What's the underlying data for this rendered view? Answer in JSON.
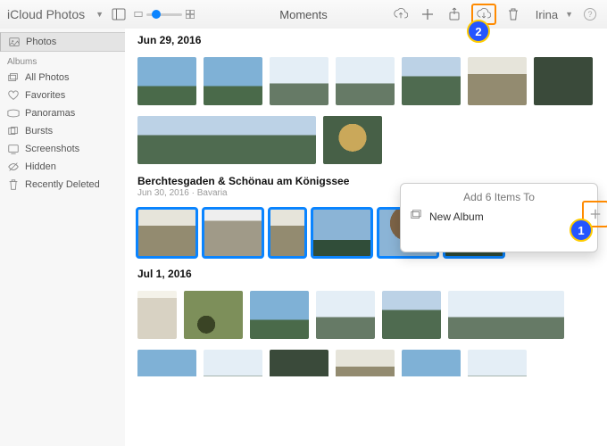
{
  "app": {
    "title": "iCloud Photos",
    "view_label": "Moments",
    "user": "Irina"
  },
  "sidebar": {
    "main": "Photos",
    "albums_header": "Albums",
    "items": [
      {
        "label": "All Photos"
      },
      {
        "label": "Favorites"
      },
      {
        "label": "Panoramas"
      },
      {
        "label": "Bursts"
      },
      {
        "label": "Screenshots"
      },
      {
        "label": "Hidden"
      },
      {
        "label": "Recently Deleted"
      }
    ]
  },
  "moments": [
    {
      "title": "Jun 29, 2016",
      "subtitle": ""
    },
    {
      "title": "Berchtesgaden & Schönau am Königssee",
      "subtitle": "Jun 30, 2016 · Bavaria"
    },
    {
      "title": "Jul 1, 2016",
      "subtitle": ""
    }
  ],
  "popup": {
    "title": "Add 6 Items To",
    "new_album": "New Album"
  },
  "callouts": {
    "one": "1",
    "two": "2"
  }
}
